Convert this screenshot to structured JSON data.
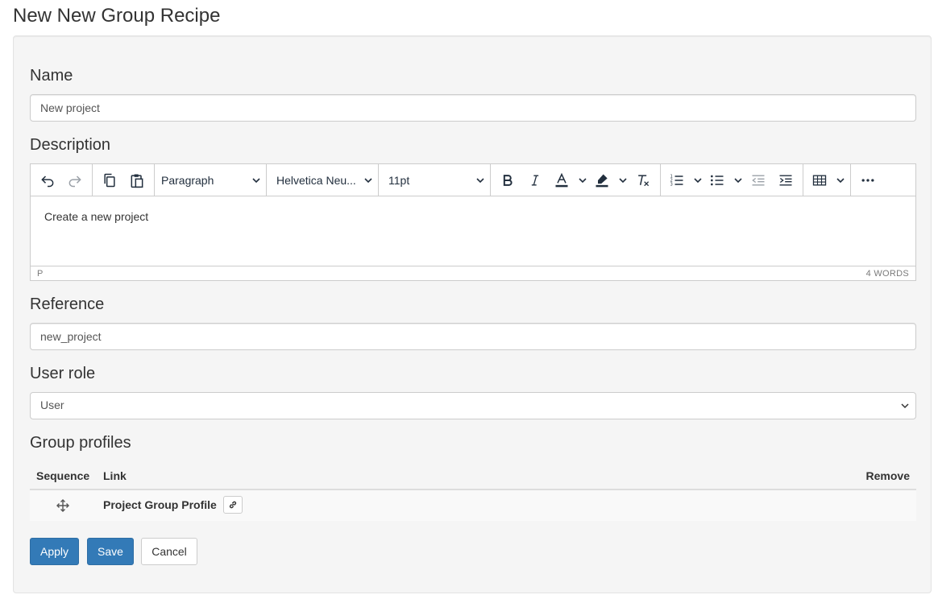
{
  "page": {
    "title": "New New Group Recipe"
  },
  "form": {
    "name": {
      "label": "Name",
      "value": "New project"
    },
    "description": {
      "label": "Description",
      "toolbar": {
        "block_format": "Paragraph",
        "font_family": "Helvetica Neu...",
        "font_size": "11pt",
        "icons": [
          "undo-icon",
          "redo-icon",
          "copy-icon",
          "paste-icon",
          "bold-icon",
          "italic-icon",
          "text-color-icon",
          "highlight-color-icon",
          "clear-formatting-icon",
          "numbered-list-icon",
          "bullet-list-icon",
          "outdent-icon",
          "indent-icon",
          "table-icon",
          "more-icon"
        ]
      },
      "content": "Create a new project",
      "status_path": "P",
      "word_count": "4 WORDS"
    },
    "reference": {
      "label": "Reference",
      "value": "new_project"
    },
    "user_role": {
      "label": "User role",
      "selected": "User"
    },
    "group_profiles": {
      "label": "Group profiles",
      "columns": {
        "sequence": "Sequence",
        "link": "Link",
        "remove": "Remove"
      },
      "rows": [
        {
          "link": "Project Group Profile"
        }
      ]
    }
  },
  "buttons": {
    "apply": "Apply",
    "save": "Save",
    "cancel": "Cancel"
  },
  "colors": {
    "primary": "#337ab7",
    "panel_bg": "#f5f5f5",
    "toolbar_icon": "#222f3e"
  }
}
